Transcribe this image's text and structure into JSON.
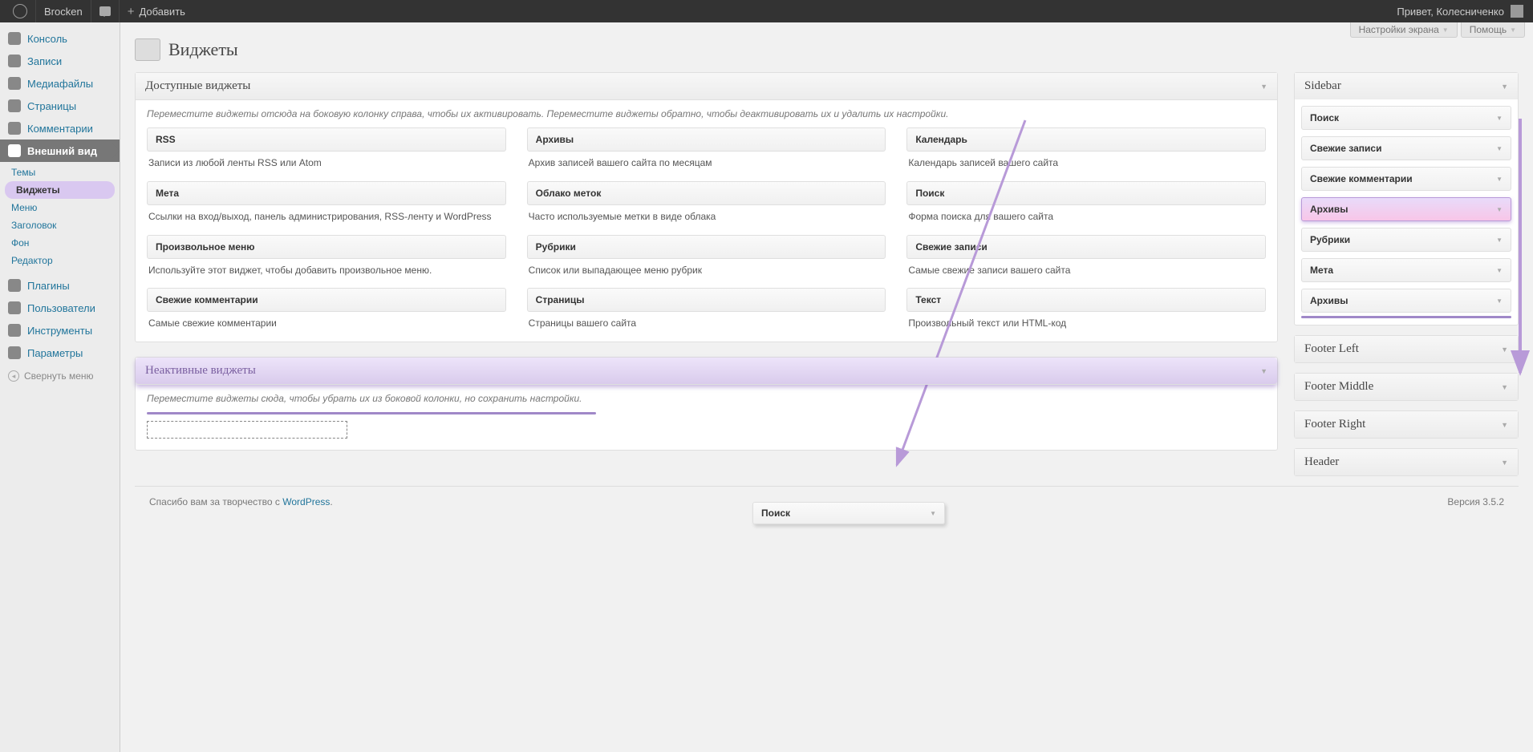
{
  "adminbar": {
    "site_name": "Brocken",
    "add_new": "Добавить",
    "greeting": "Привет, Колесниченко"
  },
  "screen_tabs": {
    "options": "Настройки экрана",
    "help": "Помощь"
  },
  "page_title": "Виджеты",
  "menu": {
    "items": [
      {
        "label": "Консоль"
      },
      {
        "label": "Записи"
      },
      {
        "label": "Медиафайлы"
      },
      {
        "label": "Страницы"
      },
      {
        "label": "Комментарии"
      },
      {
        "label": "Внешний вид",
        "current": true
      },
      {
        "label": "Плагины"
      },
      {
        "label": "Пользователи"
      },
      {
        "label": "Инструменты"
      },
      {
        "label": "Параметры"
      }
    ],
    "submenu": [
      "Темы",
      "Виджеты",
      "Меню",
      "Заголовок",
      "Фон",
      "Редактор"
    ],
    "collapse": "Свернуть меню"
  },
  "available": {
    "title": "Доступные виджеты",
    "desc": "Переместите виджеты отсюда на боковую колонку справа, чтобы их активировать. Переместите виджеты обратно, чтобы деактивировать их и удалить их настройки.",
    "widgets": [
      {
        "name": "RSS",
        "desc": "Записи из любой ленты RSS или Atom"
      },
      {
        "name": "Архивы",
        "desc": "Архив записей вашего сайта по месяцам"
      },
      {
        "name": "Календарь",
        "desc": "Календарь записей вашего сайта"
      },
      {
        "name": "Мета",
        "desc": "Ссылки на вход/выход, панель администрирования, RSS-ленту и WordPress"
      },
      {
        "name": "Облако меток",
        "desc": "Часто используемые метки в виде облака"
      },
      {
        "name": "Поиск",
        "desc": "Форма поиска для вашего сайта"
      },
      {
        "name": "Произвольное меню",
        "desc": "Используйте этот виджет, чтобы добавить произвольное меню."
      },
      {
        "name": "Рубрики",
        "desc": "Список или выпадающее меню рубрик"
      },
      {
        "name": "Свежие записи",
        "desc": "Самые свежие записи вашего сайта"
      },
      {
        "name": "Свежие комментарии",
        "desc": "Самые свежие комментарии"
      },
      {
        "name": "Страницы",
        "desc": "Страницы вашего сайта"
      },
      {
        "name": "Текст",
        "desc": "Произвольный текст или HTML-код"
      }
    ]
  },
  "inactive": {
    "title": "Неактивные виджеты",
    "desc": "Переместите виджеты сюда, чтобы убрать их из боковой колонки, но сохранить настройки."
  },
  "dragged_widget": "Поиск",
  "sidebars": {
    "main": {
      "title": "Sidebar",
      "widgets": [
        "Поиск",
        "Свежие записи",
        "Свежие комментарии",
        "Архивы",
        "Рубрики",
        "Мета",
        "Архивы"
      ]
    },
    "others": [
      "Footer Left",
      "Footer Middle",
      "Footer Right",
      "Header"
    ]
  },
  "footer": {
    "thanks_prefix": "Спасибо вам за творчество с ",
    "link": "WordPress",
    "version": "Версия 3.5.2"
  }
}
